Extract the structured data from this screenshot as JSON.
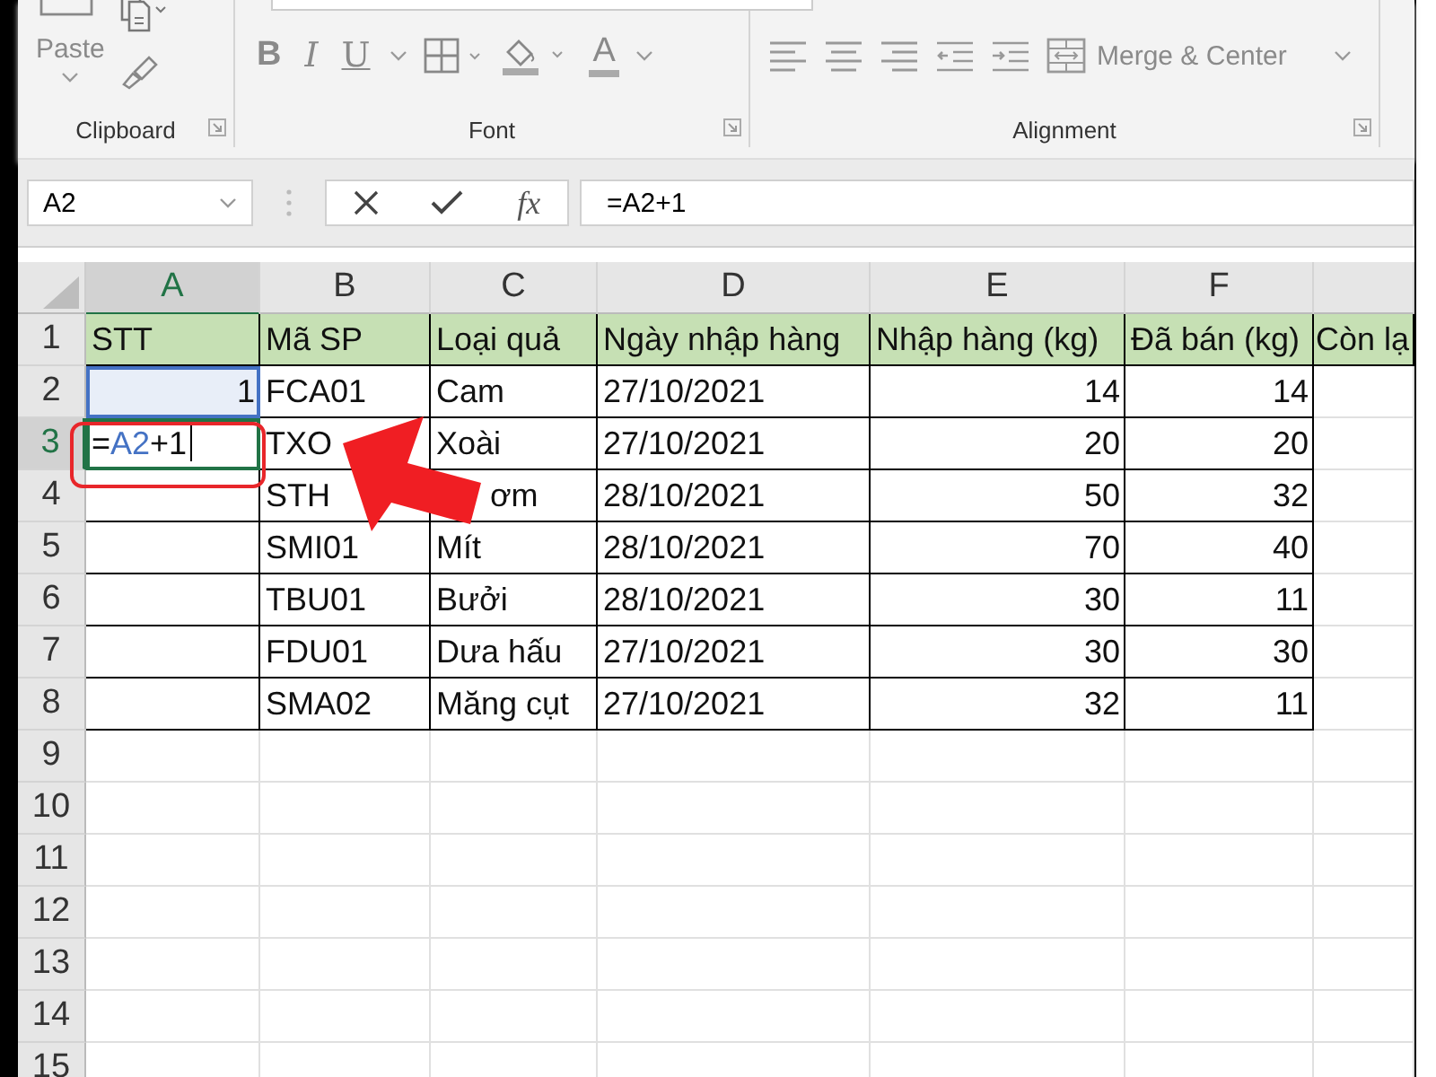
{
  "ribbon": {
    "disabled": true,
    "groups": [
      {
        "label": "Clipboard",
        "items": [
          {
            "kind": "paste",
            "label": "Paste"
          },
          {
            "kind": "copy"
          },
          {
            "kind": "painter"
          }
        ]
      },
      {
        "label": "Font",
        "items": [
          {
            "kind": "letter",
            "label": "B"
          },
          {
            "kind": "letter",
            "label": "I"
          },
          {
            "kind": "letter",
            "label": "U"
          },
          {
            "kind": "borders"
          },
          {
            "kind": "fill"
          },
          {
            "kind": "letter",
            "label": "A"
          }
        ]
      },
      {
        "label": "Alignment",
        "items": [
          {
            "kind": "align-left"
          },
          {
            "kind": "align-center"
          },
          {
            "kind": "align-right"
          },
          {
            "kind": "indent-less"
          },
          {
            "kind": "indent-more"
          },
          {
            "kind": "merge",
            "label": "Merge & Center"
          }
        ]
      }
    ]
  },
  "formula_bar": {
    "name_box": "A2",
    "insert_function": "fx",
    "formula": "=A2+1"
  },
  "sheet": {
    "columns": [
      {
        "label": "A",
        "selected": true
      },
      {
        "label": "B",
        "selected": false
      },
      {
        "label": "C",
        "selected": false
      },
      {
        "label": "D",
        "selected": false
      },
      {
        "label": "E",
        "selected": false
      },
      {
        "label": "F",
        "selected": false
      }
    ],
    "rows": [
      {
        "number": "1",
        "selected": false,
        "kind": "header",
        "cells": [
          {
            "text": "STT",
            "kind": "text"
          },
          {
            "text": "Mã SP",
            "kind": "text"
          },
          {
            "text": "Loại quả",
            "kind": "text"
          },
          {
            "text": "Ngày nhập hàng",
            "kind": "text"
          },
          {
            "text": "Nhập hàng (kg)",
            "kind": "text"
          },
          {
            "text": "Đã bán (kg)",
            "kind": "text"
          },
          {
            "text": "Còn lạ",
            "kind": "text"
          }
        ]
      },
      {
        "number": "2",
        "selected": false,
        "kind": "data",
        "cells": [
          {
            "text": "1",
            "kind": "reference"
          },
          {
            "text": "FCA01",
            "kind": "text"
          },
          {
            "text": "Cam",
            "kind": "text"
          },
          {
            "text": "27/10/2021",
            "kind": "text"
          },
          {
            "text": "14",
            "kind": "number"
          },
          {
            "text": "14",
            "kind": "number"
          },
          null
        ]
      },
      {
        "number": "3",
        "selected": true,
        "kind": "data",
        "cells": [
          {
            "kind": "editing",
            "parts": [
              {
                "text": "=",
                "kind": "plain"
              },
              {
                "text": "A2",
                "kind": "ref"
              },
              {
                "text": "+1",
                "kind": "plain"
              }
            ]
          },
          {
            "text": "TXO",
            "kind": "text"
          },
          {
            "text": "Xoài",
            "kind": "text"
          },
          {
            "text": "27/10/2021",
            "kind": "text"
          },
          {
            "text": "20",
            "kind": "number"
          },
          {
            "text": "20",
            "kind": "number"
          },
          null
        ]
      },
      {
        "number": "4",
        "selected": false,
        "kind": "data",
        "cells": [
          null,
          {
            "text": "STH",
            "kind": "text"
          },
          {
            "text": "ơm",
            "kind": "covered"
          },
          {
            "text": "28/10/2021",
            "kind": "text"
          },
          {
            "text": "50",
            "kind": "number"
          },
          {
            "text": "32",
            "kind": "number"
          },
          null
        ]
      },
      {
        "number": "5",
        "selected": false,
        "kind": "data",
        "cells": [
          null,
          {
            "text": "SMI01",
            "kind": "text"
          },
          {
            "text": "Mít",
            "kind": "text"
          },
          {
            "text": "28/10/2021",
            "kind": "text"
          },
          {
            "text": "70",
            "kind": "number"
          },
          {
            "text": "40",
            "kind": "number"
          },
          null
        ]
      },
      {
        "number": "6",
        "selected": false,
        "kind": "data",
        "cells": [
          null,
          {
            "text": "TBU01",
            "kind": "text"
          },
          {
            "text": "Bưởi",
            "kind": "text"
          },
          {
            "text": "28/10/2021",
            "kind": "text"
          },
          {
            "text": "30",
            "kind": "number"
          },
          {
            "text": "11",
            "kind": "number"
          },
          null
        ]
      },
      {
        "number": "7",
        "selected": false,
        "kind": "data",
        "cells": [
          null,
          {
            "text": "FDU01",
            "kind": "text"
          },
          {
            "text": "Dưa hấu",
            "kind": "text"
          },
          {
            "text": "27/10/2021",
            "kind": "text"
          },
          {
            "text": "30",
            "kind": "number"
          },
          {
            "text": "30",
            "kind": "number"
          },
          null
        ]
      },
      {
        "number": "8",
        "selected": false,
        "kind": "data",
        "cells": [
          null,
          {
            "text": "SMA02",
            "kind": "text"
          },
          {
            "text": "Măng cụt",
            "kind": "text"
          },
          {
            "text": "27/10/2021",
            "kind": "text"
          },
          {
            "text": "32",
            "kind": "number"
          },
          {
            "text": "11",
            "kind": "number"
          },
          null
        ]
      },
      {
        "number": "9",
        "selected": false,
        "kind": "blank"
      },
      {
        "number": "10",
        "selected": false,
        "kind": "blank"
      },
      {
        "number": "11",
        "selected": false,
        "kind": "blank"
      },
      {
        "number": "12",
        "selected": false,
        "kind": "blank"
      },
      {
        "number": "13",
        "selected": false,
        "kind": "blank"
      },
      {
        "number": "14",
        "selected": false,
        "kind": "blank"
      },
      {
        "number": "15",
        "selected": false,
        "kind": "blank"
      }
    ],
    "annotations": {
      "frame": true,
      "arrow": true
    }
  }
}
